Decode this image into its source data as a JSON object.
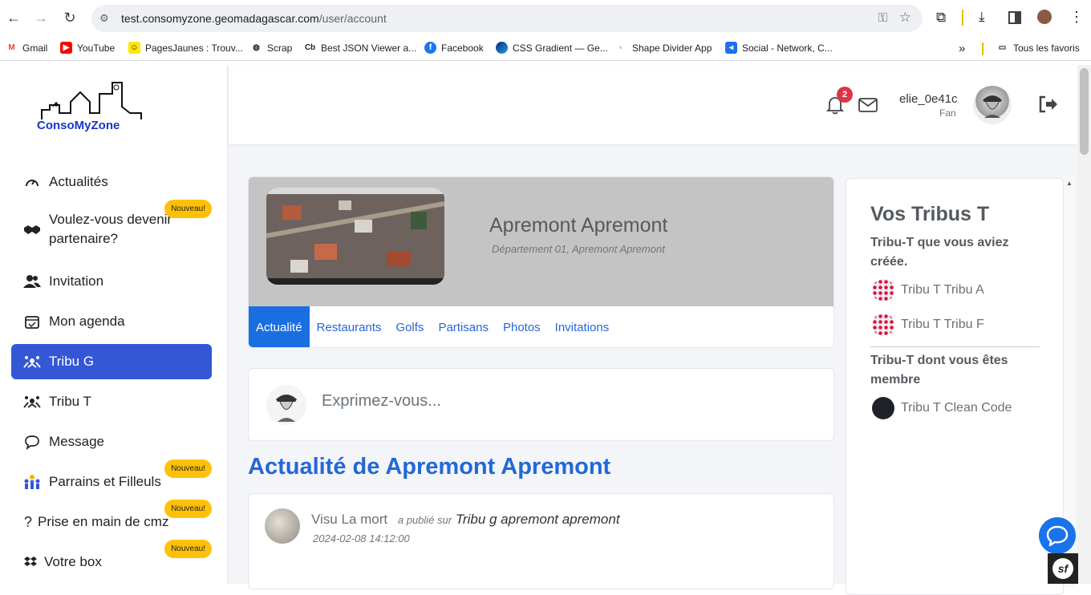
{
  "browser": {
    "url_host": "test.consomyzone.geomadagascar.com",
    "url_path": "/user/account",
    "bookmarks": [
      {
        "label": "Gmail",
        "icon": "gmail-icon"
      },
      {
        "label": "YouTube",
        "icon": "youtube-icon"
      },
      {
        "label": "PagesJaunes : Trouv...",
        "icon": "pagesjaunes-icon"
      },
      {
        "label": "Scrap",
        "icon": "globe-icon"
      },
      {
        "label": "Best JSON Viewer a...",
        "icon": "cb-icon"
      },
      {
        "label": "Facebook",
        "icon": "facebook-icon"
      },
      {
        "label": "CSS Gradient — Ge...",
        "icon": "css-gradient-icon"
      },
      {
        "label": "Shape Divider App",
        "icon": "shape-divider-icon"
      },
      {
        "label": "Social - Network, C...",
        "icon": "social-icon"
      }
    ],
    "all_bookmarks": "Tous les favoris"
  },
  "logo": {
    "text": "ConsoMyZone"
  },
  "sidebar": {
    "items": [
      {
        "label": "Actualités",
        "icon": "gauge-icon"
      },
      {
        "label": "Voulez-vous devenir partenaire?",
        "icon": "handshake-icon",
        "badge": "Nouveau!"
      },
      {
        "label": "Invitation",
        "icon": "users-icon"
      },
      {
        "label": "Mon agenda",
        "icon": "calendar-icon"
      },
      {
        "label": "Tribu G",
        "icon": "tribe-icon",
        "active": true
      },
      {
        "label": "Tribu T",
        "icon": "tribe-icon"
      },
      {
        "label": "Message",
        "icon": "chat-icon"
      },
      {
        "label": "Parrains et Filleuls",
        "icon": "sponsors-icon",
        "badge": "Nouveau!"
      },
      {
        "label": "Prise en main de cmz",
        "icon": "question-icon",
        "badge": "Nouveau!"
      },
      {
        "label": "Votre box",
        "icon": "dropbox-icon",
        "badge": "Nouveau!"
      }
    ]
  },
  "header": {
    "notification_count": "2",
    "username": "elie_0e41c",
    "role": "Fan"
  },
  "tribu": {
    "name": "Apremont Apremont",
    "location": "Département 01, Apremont Apremont",
    "tabs": [
      "Actualité",
      "Restaurants",
      "Golfs",
      "Partisans",
      "Photos",
      "Invitations"
    ],
    "active_tab": "Actualité"
  },
  "composer": {
    "placeholder": "Exprimez-vous..."
  },
  "feed": {
    "title": "Actualité de Apremont Apremont",
    "posts": [
      {
        "author": "Visu La mort",
        "verb": "a publié sur",
        "target": "Tribu g apremont apremont",
        "date": "2024-02-08 14:12:00"
      }
    ]
  },
  "right_panel": {
    "title": "Vos Tribus T",
    "created_heading": "Tribu-T que vous aviez créée.",
    "created": [
      "Tribu T Tribu A",
      "Tribu T Tribu F"
    ],
    "member_heading": "Tribu-T dont vous êtes membre",
    "member": [
      "Tribu T Clean Code"
    ]
  },
  "colors": {
    "accent": "#3457d5",
    "link": "#2368d6",
    "badge": "#ffc107",
    "notif": "#dc3545"
  }
}
